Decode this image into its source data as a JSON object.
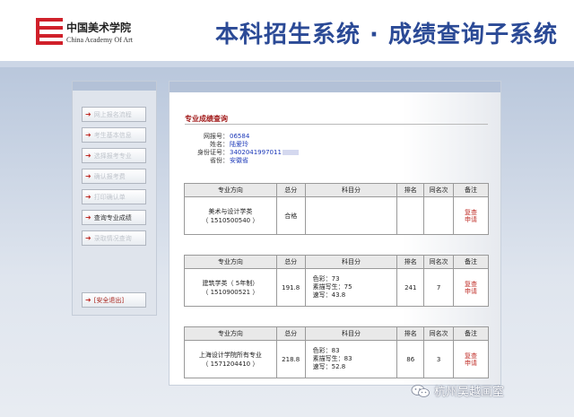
{
  "header": {
    "logo_cn": "中国美术学院",
    "logo_en": "China Academy Of Art",
    "system_title": "本科招生系统 · 成绩查询子系统"
  },
  "sidebar": {
    "items": [
      {
        "label": "网上报名流程"
      },
      {
        "label": "考生基本信息"
      },
      {
        "label": "选择报考专业"
      },
      {
        "label": "确认报考费"
      },
      {
        "label": "打印确认单"
      },
      {
        "label": "查询专业成绩"
      },
      {
        "label": "录取情况查询"
      }
    ],
    "logout_label": "[安全退出]"
  },
  "main": {
    "section_title": "专业成绩查询",
    "info": {
      "reg_label": "网报号：",
      "reg_value": "06584",
      "name_label": "姓名：",
      "name_value": "陆爱玲",
      "id_label": "身份证号：",
      "id_value": "3402041997011",
      "province_label": "省份：",
      "province_value": "安徽省"
    },
    "table_headers": [
      "专业方向",
      "总分",
      "科目分",
      "排名",
      "同名次",
      "备注"
    ],
    "recheck_line1": "复查",
    "recheck_line2": "申请",
    "tables": [
      {
        "major": "美术与设计学类",
        "code": "（ 1510500540 ）",
        "total": "合格",
        "subjects": [],
        "rank": "",
        "same_rank": ""
      },
      {
        "major": "建筑学类（ 5年制）",
        "code": "（ 1510900521 ）",
        "total": "191.8",
        "subjects": [
          "色彩：73",
          "素描写生：75",
          "速写：43.8"
        ],
        "rank": "241",
        "same_rank": "7"
      },
      {
        "major": "上海设计学院所有专业",
        "code": "（ 1571204410 ）",
        "total": "218.8",
        "subjects": [
          "色彩：83",
          "素描写生：83",
          "速写：52.8"
        ],
        "rank": "86",
        "same_rank": "3"
      }
    ]
  },
  "watermark": {
    "text": "杭州吴越画室"
  }
}
